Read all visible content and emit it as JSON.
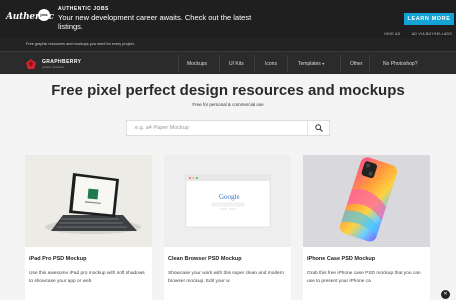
{
  "ad": {
    "logo_text": "Authentic",
    "badge_text": "jobs",
    "title": "AUTHENTIC JOBS",
    "text": "Your new development career awaits. Check out the latest listings.",
    "cta_label": "LEARN MORE",
    "links": [
      "HIDE AD",
      "AD VIA BUYSELLADS"
    ]
  },
  "tagline": "Free graphic resources and mockups you need for every project.",
  "nav": {
    "brand": "GRAPHBERRY",
    "brand_sub": "graphic resources",
    "items": [
      "Mockups",
      "UI Kits",
      "Icons",
      "Templates",
      "Other",
      "No Photoshop?"
    ]
  },
  "hero": {
    "title": "Free pixel perfect design resources and mockups",
    "subtitle": "Free for personal & commercial use"
  },
  "search": {
    "placeholder": "e.g. a4 Paper Mockup"
  },
  "cards": [
    {
      "title": "iPad Pro PSD Mockup",
      "desc": "Use this awesome iPad pro mockup with soft shadows to showcase your app or web"
    },
    {
      "title": "Clean Browser PSD Mockup",
      "desc": "Showcase your work with this super clean and modern browser mockup. Edit your w"
    },
    {
      "title": "iPhone Case PSD Mockup",
      "desc": "Grab this free iPhone case PSD mockup that you can use to present your iPhone ca"
    }
  ],
  "browser_logo": "Google",
  "colors": {
    "accent": "#14a3d6",
    "brand_red": "#d9232e",
    "nav_bg": "#2b2b2b"
  },
  "icons": [
    "search-icon",
    "close-icon",
    "chevron-down-icon"
  ]
}
